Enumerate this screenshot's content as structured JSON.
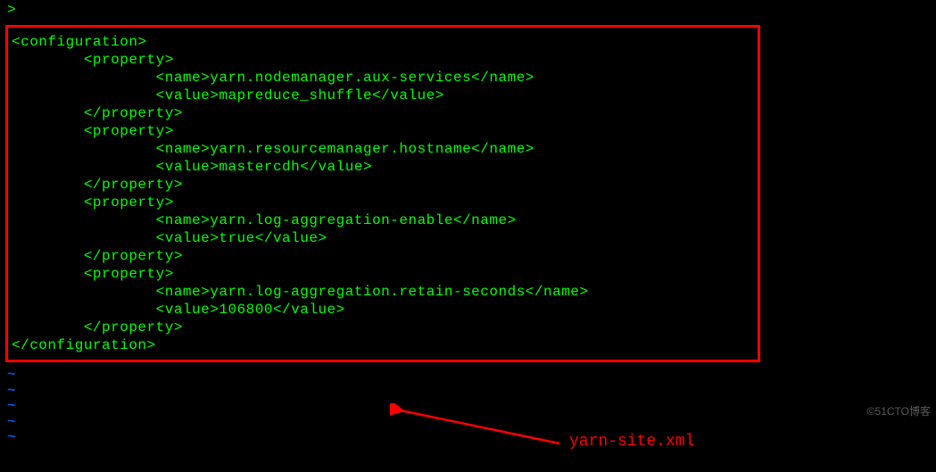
{
  "prompt_top": ">",
  "xml": {
    "line0": "<configuration>",
    "line1": "        <property>",
    "line2": "                <name>yarn.nodemanager.aux-services</name>",
    "line3": "                <value>mapreduce_shuffle</value>",
    "line4": "        </property>",
    "line5": "",
    "line6": "        <property>",
    "line7": "                <name>yarn.resourcemanager.hostname</name>",
    "line8": "                <value>mastercdh</value>",
    "line9": "        </property>",
    "line10": "        <property>",
    "line11": "                <name>yarn.log-aggregation-enable</name>",
    "line12": "                <value>true</value>",
    "line13": "        </property>",
    "line14": "        <property>",
    "line15": "                <name>yarn.log-aggregation.retain-seconds</name>",
    "line16": "                <value>106800</value>",
    "line17": "        </property>",
    "line18": "</configuration>"
  },
  "tilde": "~",
  "annotation_label": "yarn-site.xml",
  "watermark": "©51CTO博客"
}
